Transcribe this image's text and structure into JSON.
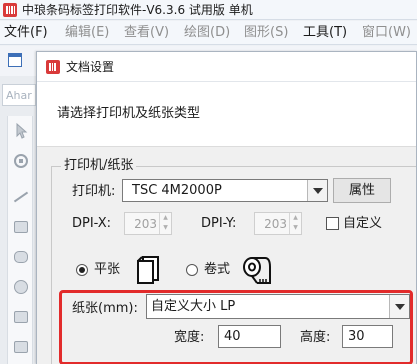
{
  "app": {
    "title": "中琅条码标签打印软件-V6.3.6 试用版 单机"
  },
  "menu": {
    "items": [
      {
        "label": "文件(F)",
        "enabled": true
      },
      {
        "label": "编辑(E)",
        "enabled": false
      },
      {
        "label": "查看(V)",
        "enabled": false
      },
      {
        "label": "绘图(D)",
        "enabled": false
      },
      {
        "label": "图形(S)",
        "enabled": false
      },
      {
        "label": "工具(T)",
        "enabled": true
      },
      {
        "label": "窗口(W)",
        "enabled": false
      }
    ]
  },
  "sidebar": {
    "search_text": "Ahar"
  },
  "dialog": {
    "title": "文档设置",
    "instruction": "请选择打印机及纸张类型",
    "group_title": "打印机/纸张",
    "printer_label": "打印机:",
    "printer_value": "TSC 4M2000P",
    "properties_button": "属性",
    "dpi_x_label": "DPI-X:",
    "dpi_x_value": "203",
    "dpi_y_label": "DPI-Y:",
    "dpi_y_value": "203",
    "custom_label": "自定义",
    "custom_checked": false,
    "paper_type_sheet_label": "平张",
    "paper_type_roll_label": "卷式",
    "paper_type_selected": "平张",
    "paper_label": "纸张(mm):",
    "paper_value": "自定义大小 LP",
    "width_label": "宽度:",
    "width_value": "40",
    "height_label": "高度:",
    "height_value": "30"
  },
  "colors": {
    "highlight": "#e22b2b",
    "app_icon_red": "#d93a3a"
  }
}
